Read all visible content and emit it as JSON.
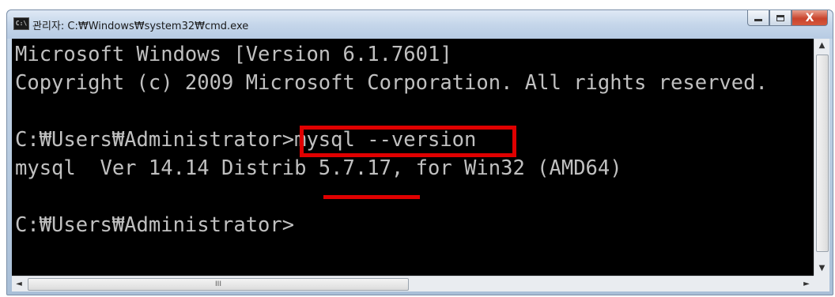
{
  "window": {
    "title": "관리자: C:₩Windows₩system32₩cmd.exe",
    "icon": "cmd-icon",
    "controls": {
      "minimize": "minimize-icon",
      "maximize": "maximize-icon",
      "close": "X"
    }
  },
  "console": {
    "lines": [
      "Microsoft Windows [Version 6.1.7601]",
      "Copyright (c) 2009 Microsoft Corporation. All rights reserved.",
      "",
      "C:₩Users₩Administrator>mysql --version",
      "mysql  Ver 14.14 Distrib 5.7.17, for Win32 (AMD64)",
      "",
      "C:₩Users₩Administrator>"
    ]
  },
  "annotations": {
    "highlight_box_color": "#e00000",
    "underline_color": "#e00000"
  },
  "scrollbar": {
    "hthumb_label": "III",
    "left_arrow": "◄",
    "right_arrow": "►",
    "up_arrow": "▲",
    "down_arrow": "▼"
  }
}
